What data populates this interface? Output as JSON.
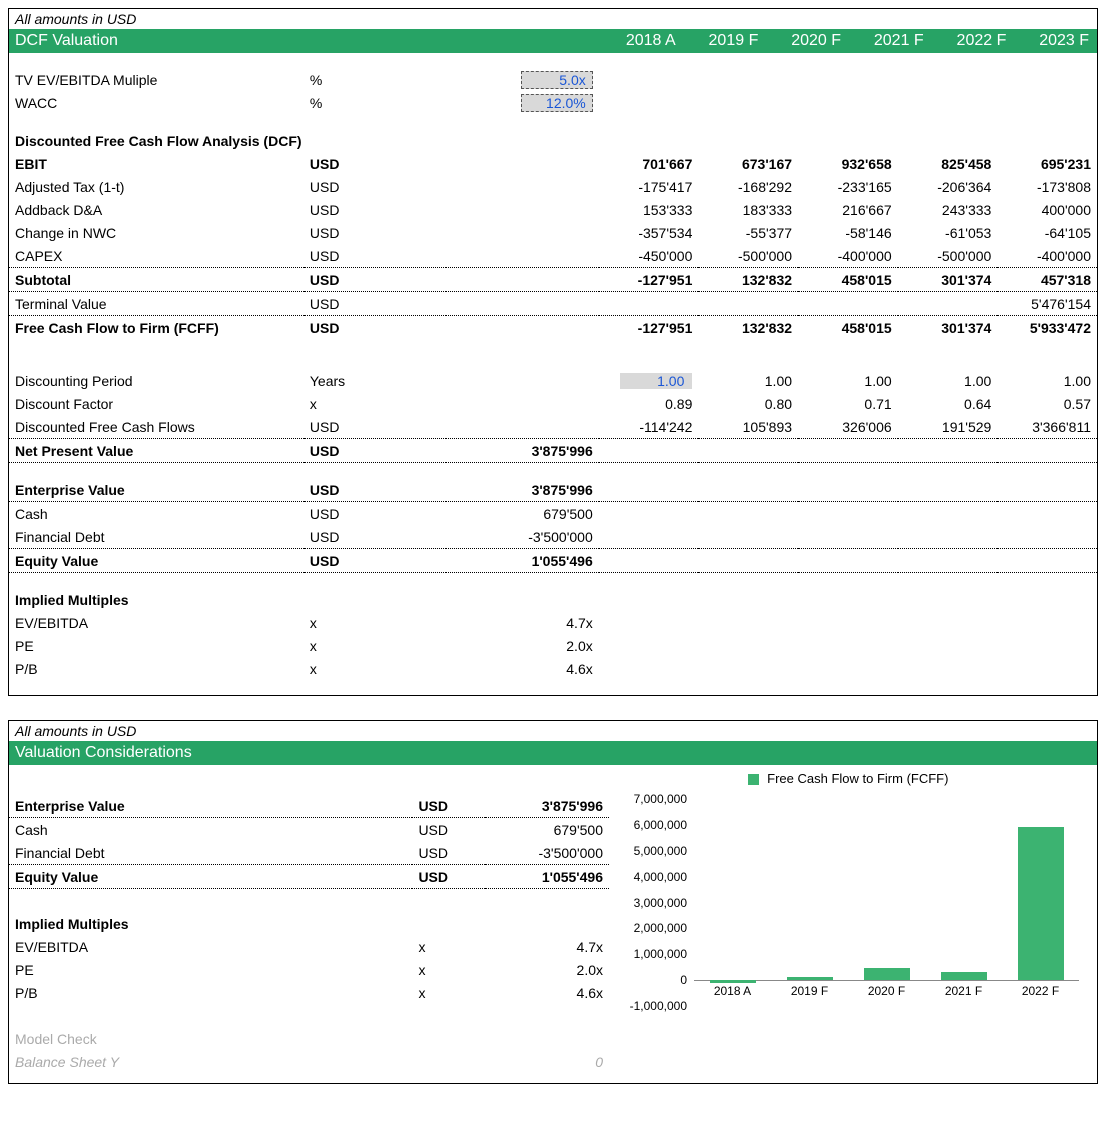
{
  "currency_caption": "All amounts in USD",
  "section1": {
    "title": "DCF Valuation",
    "year_headers": [
      "2018 A",
      "2019 F",
      "2020 F",
      "2021 F",
      "2022 F",
      "2023 F"
    ],
    "inputs": {
      "tv_label": "TV EV/EBITDA Muliple",
      "tv_unit": "%",
      "tv_value": "5.0x",
      "wacc_label": "WACC",
      "wacc_unit": "%",
      "wacc_value": "12.0%"
    },
    "dcf_heading": "Discounted Free Cash Flow Analysis (DCF)",
    "rows": {
      "ebit": {
        "label": "EBIT",
        "unit": "USD",
        "v": [
          "701'667",
          "673'167",
          "932'658",
          "825'458",
          "695'231"
        ]
      },
      "tax": {
        "label": "Adjusted Tax (1-t)",
        "unit": "USD",
        "v": [
          "-175'417",
          "-168'292",
          "-233'165",
          "-206'364",
          "-173'808"
        ]
      },
      "da": {
        "label": "Addback D&A",
        "unit": "USD",
        "v": [
          "153'333",
          "183'333",
          "216'667",
          "243'333",
          "400'000"
        ]
      },
      "nwc": {
        "label": "Change in NWC",
        "unit": "USD",
        "v": [
          "-357'534",
          "-55'377",
          "-58'146",
          "-61'053",
          "-64'105"
        ]
      },
      "capex": {
        "label": "CAPEX",
        "unit": "USD",
        "v": [
          "-450'000",
          "-500'000",
          "-400'000",
          "-500'000",
          "-400'000"
        ]
      },
      "subtotal": {
        "label": "Subtotal",
        "unit": "USD",
        "v": [
          "-127'951",
          "132'832",
          "458'015",
          "301'374",
          "457'318"
        ]
      },
      "tv": {
        "label": "Terminal Value",
        "unit": "USD",
        "v": [
          "",
          "",
          "",
          "",
          "5'476'154"
        ]
      },
      "fcff": {
        "label": "Free Cash Flow to Firm (FCFF)",
        "unit": "USD",
        "v": [
          "-127'951",
          "132'832",
          "458'015",
          "301'374",
          "5'933'472"
        ]
      },
      "period": {
        "label": "Discounting Period",
        "unit": "Years",
        "v": [
          "1.00",
          "1.00",
          "1.00",
          "1.00",
          "1.00"
        ]
      },
      "dfactor": {
        "label": "Discount Factor",
        "unit": "x",
        "v": [
          "0.89",
          "0.80",
          "0.71",
          "0.64",
          "0.57"
        ]
      },
      "dfcf": {
        "label": "Discounted Free Cash Flows",
        "unit": "USD",
        "v": [
          "-114'242",
          "105'893",
          "326'006",
          "191'529",
          "3'366'811"
        ]
      },
      "npv": {
        "label": "Net Present Value",
        "unit": "USD",
        "v2018": "3'875'996"
      },
      "ev": {
        "label": "Enterprise Value",
        "unit": "USD",
        "v2018": "3'875'996"
      },
      "cash": {
        "label": "Cash",
        "unit": "USD",
        "v2018": "679'500"
      },
      "debt": {
        "label": "Financial Debt",
        "unit": "USD",
        "v2018": "-3'500'000"
      },
      "equity": {
        "label": "Equity Value",
        "unit": "USD",
        "v2018": "1'055'496"
      }
    },
    "implied_heading": "Implied Multiples",
    "implied": {
      "evebitda": {
        "label": "EV/EBITDA",
        "unit": "x",
        "v": "4.7x"
      },
      "pe": {
        "label": "PE",
        "unit": "x",
        "v": "2.0x"
      },
      "pb": {
        "label": "P/B",
        "unit": "x",
        "v": "4.6x"
      }
    }
  },
  "section2": {
    "title": "Valuation Considerations",
    "rows": {
      "ev": {
        "label": "Enterprise Value",
        "unit": "USD",
        "v": "3'875'996"
      },
      "cash": {
        "label": "Cash",
        "unit": "USD",
        "v": "679'500"
      },
      "debt": {
        "label": "Financial Debt",
        "unit": "USD",
        "v": "-3'500'000"
      },
      "equity": {
        "label": "Equity Value",
        "unit": "USD",
        "v": "1'055'496"
      }
    },
    "implied_heading": "Implied Multiples",
    "implied": {
      "evebitda": {
        "label": "EV/EBITDA",
        "unit": "x",
        "v": "4.7x"
      },
      "pe": {
        "label": "PE",
        "unit": "x",
        "v": "2.0x"
      },
      "pb": {
        "label": "P/B",
        "unit": "x",
        "v": "4.6x"
      }
    },
    "model_check_label": "Model Check",
    "balance_label": "Balance Sheet Y",
    "balance_val": "0"
  },
  "chart_data": {
    "type": "bar",
    "title": "",
    "legend": "Free Cash Flow to Firm (FCFF)",
    "categories": [
      "2018 A",
      "2019 F",
      "2020 F",
      "2021 F",
      "2022 F"
    ],
    "values": [
      -127951,
      132832,
      458015,
      301374,
      5933472
    ],
    "ylabel": "",
    "ylim": [
      -1000000,
      7000000
    ],
    "yticks": [
      -1000000,
      0,
      1000000,
      2000000,
      3000000,
      4000000,
      5000000,
      6000000,
      7000000
    ],
    "ytick_labels": [
      "-1,000,000",
      "0",
      "1,000,000",
      "2,000,000",
      "3,000,000",
      "4,000,000",
      "5,000,000",
      "6,000,000",
      "7,000,000"
    ]
  }
}
